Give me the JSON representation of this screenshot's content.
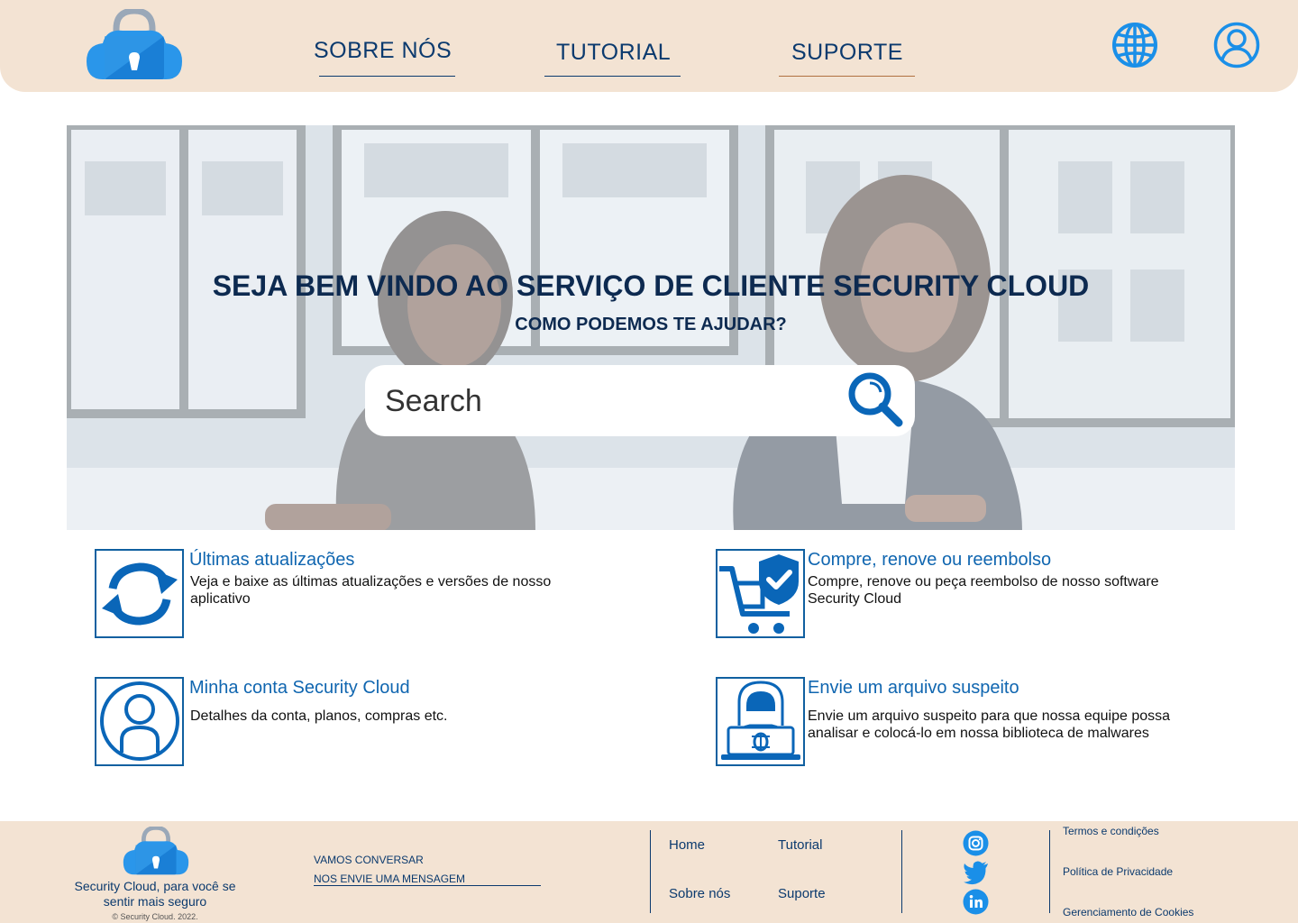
{
  "header": {
    "nav": [
      {
        "label": "SOBRE NÓS"
      },
      {
        "label": "TUTORIAL"
      },
      {
        "label": "SUPORTE"
      }
    ],
    "icons": [
      "globe-icon",
      "user-account-icon"
    ]
  },
  "hero": {
    "title": "SEJA BEM VINDO AO SERVIÇO DE CLIENTE SECURITY CLOUD",
    "subtitle": "COMO PODEMOS TE AJUDAR?",
    "search_placeholder": "Search"
  },
  "cards": [
    {
      "title": "Últimas atualizações",
      "desc": "Veja e baixe as últimas atualizações e versões de nosso aplicativo",
      "icon": "refresh-icon"
    },
    {
      "title": "Compre, renove ou reembolso",
      "desc": "Compre, renove ou peça reembolso de nosso software Security Cloud",
      "icon": "cart-shield-icon"
    },
    {
      "title": "Minha conta Security Cloud",
      "desc": "Detalhes da conta, planos, compras etc.",
      "icon": "account-icon"
    },
    {
      "title": " Envie um arquivo suspeito",
      "desc": "Envie um arquivo suspeito para que nossa equipe possa analisar e colocá-lo em nossa biblioteca de malwares",
      "icon": "hacker-icon"
    }
  ],
  "footer": {
    "tagline": "Security Cloud, para você se sentir mais seguro",
    "copyright": "© Security Cloud. 2022.",
    "talk_label": "VAMOS CONVERSAR",
    "message_label": "NOS ENVIE UMA MENSAGEM",
    "links": [
      "Home",
      "Tutorial",
      "Sobre nós",
      "Suporte"
    ],
    "social": [
      "instagram-icon",
      "twitter-icon",
      "linkedin-icon"
    ],
    "legal": [
      "Termos e condições",
      "Política de Privacidade",
      "Gerenciamento de Cookies"
    ]
  },
  "colors": {
    "header_bg": "#f3e3d3",
    "brand_blue": "#1a8fe8",
    "dark_navy": "#0d2a50",
    "link_blue": "#1066b0"
  }
}
